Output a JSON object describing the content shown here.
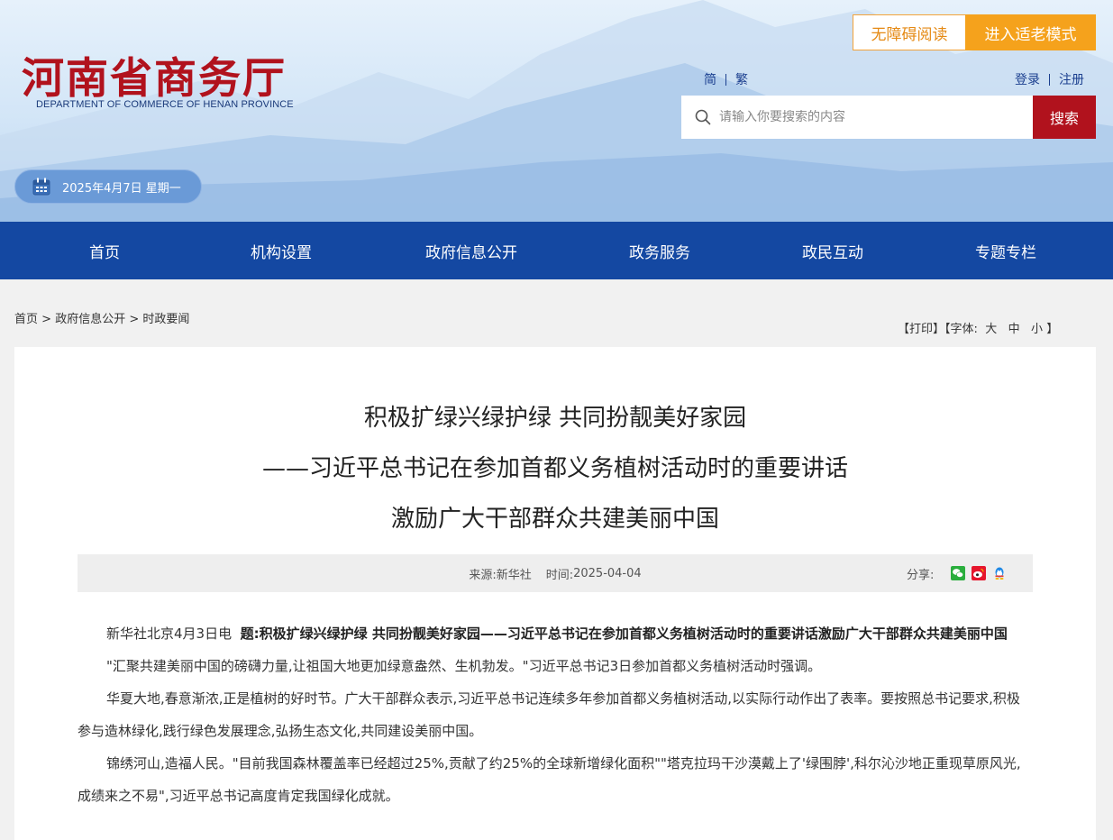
{
  "header": {
    "logo_cn": "河南省商务厅",
    "logo_en": "DEPARTMENT OF COMMERCE OF HENAN PROVINCE",
    "accessibility_label": "无障碍阅读",
    "elder_mode_label": "进入适老模式",
    "lang_simplified": "简",
    "lang_traditional": "繁",
    "login_label": "登录",
    "register_label": "注册",
    "search_placeholder": "请输入你要搜索的内容",
    "search_button": "搜索",
    "date": "2025年4月7日 星期一"
  },
  "nav": {
    "items": [
      {
        "label": "首页"
      },
      {
        "label": "机构设置"
      },
      {
        "label": "政府信息公开"
      },
      {
        "label": "政务服务"
      },
      {
        "label": "政民互动"
      },
      {
        "label": "专题专栏"
      }
    ]
  },
  "breadcrumb": {
    "items": [
      "首页",
      "政府信息公开",
      "时政要闻"
    ],
    "separator": ">"
  },
  "tools": {
    "print": "打印",
    "font_label": "字体:",
    "large": "大",
    "medium": "中",
    "small": "小"
  },
  "article": {
    "title_lines": [
      "积极扩绿兴绿护绿 共同扮靓美好家园",
      "——习近平总书记在参加首都义务植树活动时的重要讲话",
      "激励广大干部群众共建美丽中国"
    ],
    "source_label": "来源:",
    "source": "新华社",
    "time_label": "时间:",
    "time": "2025-04-04",
    "share_label": "分享:",
    "dateline": "新华社北京4月3日电",
    "headline_prefix": "题:",
    "headline": "积极扩绿兴绿护绿 共同扮靓美好家园——习近平总书记在参加首都义务植树活动时的重要讲话激励广大干部群众共建美丽中国",
    "paragraphs": [
      "\"汇聚共建美丽中国的磅礴力量,让祖国大地更加绿意盎然、生机勃发。\"习近平总书记3日参加首都义务植树活动时强调。",
      "华夏大地,春意渐浓,正是植树的好时节。广大干部群众表示,习近平总书记连续多年参加首都义务植树活动,以实际行动作出了表率。要按照总书记要求,积极参与造林绿化,践行绿色发展理念,弘扬生态文化,共同建设美丽中国。",
      "锦绣河山,造福人民。\"目前我国森林覆盖率已经超过25%,贡献了约25%的全球新增绿化面积\"\"塔克拉玛干沙漠戴上了'绿围脖',科尔沁沙地正重现草原风光,成绩来之不易\",习近平总书记高度肯定我国绿化成就。"
    ]
  },
  "colors": {
    "brand_red": "#b1121d",
    "nav_blue": "#1448a2",
    "accent_orange": "#f5a21c"
  },
  "icons": [
    "search-icon",
    "calendar-icon",
    "wechat-icon",
    "weibo-icon",
    "qq-icon"
  ]
}
